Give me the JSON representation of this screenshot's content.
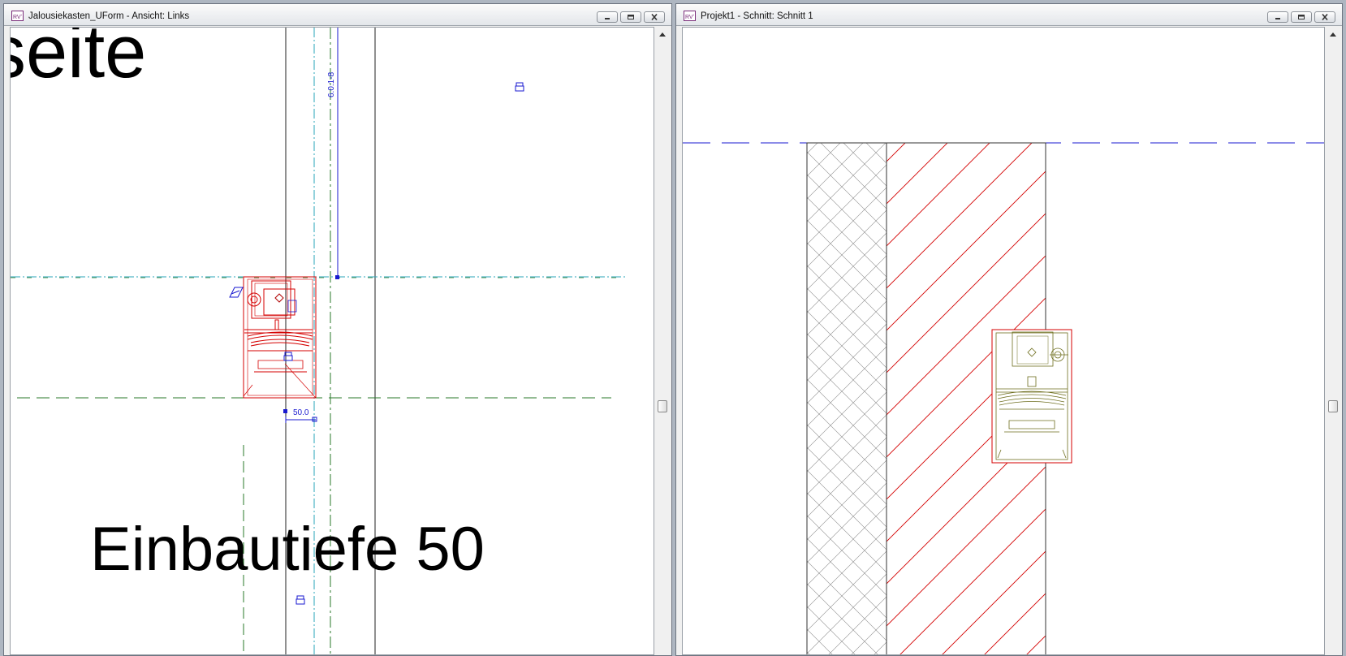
{
  "left_window": {
    "title": "Jalousiekasten_UForm - Ansicht: Links",
    "partial_heading": "seite",
    "depth_label": "Einbautiefe 50",
    "dimension_vertical": "6.0.1-8",
    "dimension_horizontal": "50.0"
  },
  "right_window": {
    "title": "Projekt1 - Schnitt: Schnitt 1"
  },
  "colors": {
    "accent_red": "#d40000",
    "reference_green": "#2a7a2a",
    "annotation_blue": "#1a1ad0",
    "cyan_axis": "#2aa6b8",
    "family_olive": "#6e6e1e"
  },
  "icons": [
    "app-icon",
    "minimize-icon",
    "restore-icon",
    "close-icon",
    "scroll-up-arrow-icon"
  ]
}
